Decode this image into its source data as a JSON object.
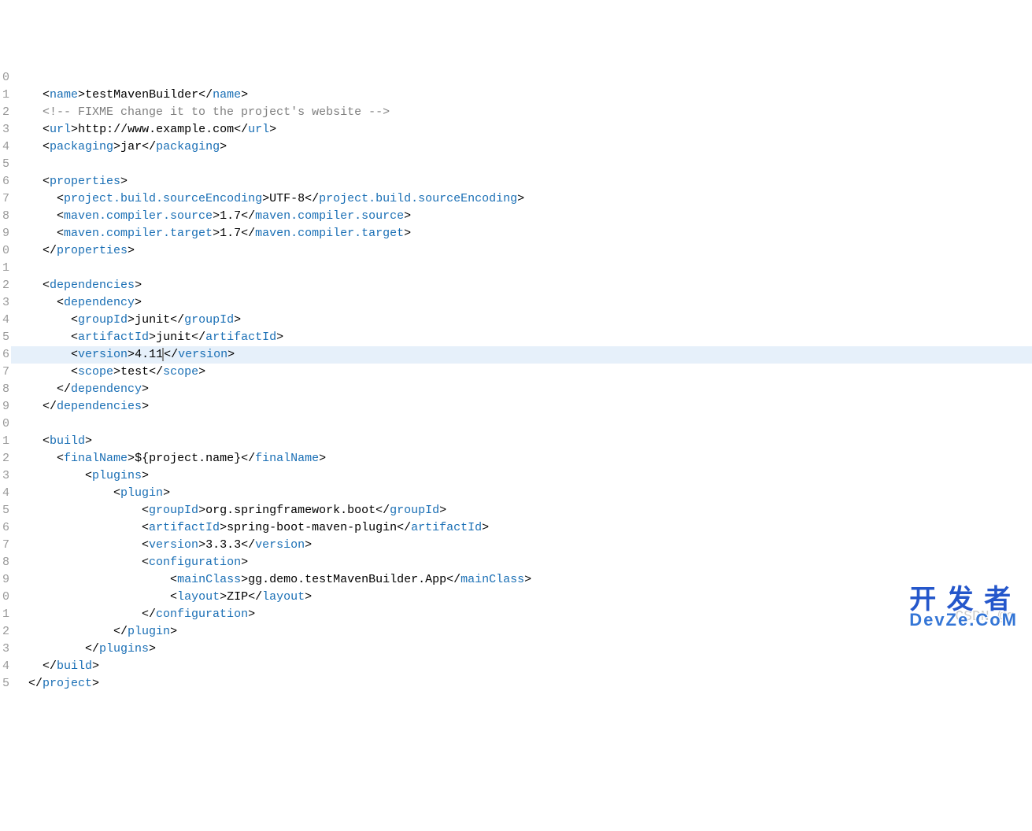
{
  "gutter": [
    "0",
    "1",
    "2",
    "3",
    "4",
    "5",
    "6*",
    "7",
    "8",
    "9",
    "0",
    "1",
    "2",
    "3*",
    "4",
    "5",
    "6",
    "7",
    "8",
    "9",
    "0",
    "1*",
    "2",
    "3*",
    "4*",
    "5",
    "6",
    "7",
    "8*",
    "9",
    "0",
    "1",
    "2",
    "3",
    "4",
    "5"
  ],
  "code": {
    "lines": [
      {
        "indent": 2,
        "open": "name",
        "text": "testMavenBuilder",
        "close": "name"
      },
      {
        "indent": 2,
        "comment": "<!-- FIXME change it to the project's website -->"
      },
      {
        "indent": 2,
        "open": "url",
        "text": "http://www.example.com",
        "close": "url"
      },
      {
        "indent": 2,
        "open": "packaging",
        "text": "jar",
        "close": "packaging"
      },
      {
        "blank": true
      },
      {
        "indent": 2,
        "open": "properties"
      },
      {
        "indent": 4,
        "open": "project.build.sourceEncoding",
        "text": "UTF-8",
        "close": "project.build.sourceEncoding"
      },
      {
        "indent": 4,
        "open": "maven.compiler.source",
        "text": "1.7",
        "close": "maven.compiler.source"
      },
      {
        "indent": 4,
        "open": "maven.compiler.target",
        "text": "1.7",
        "close": "maven.compiler.target"
      },
      {
        "indent": 2,
        "closetag": "properties"
      },
      {
        "blank": true
      },
      {
        "indent": 2,
        "open": "dependencies"
      },
      {
        "indent": 4,
        "open": "dependency"
      },
      {
        "indent": 6,
        "open": "groupId",
        "text": "junit",
        "close": "groupId"
      },
      {
        "indent": 6,
        "open": "artifactId",
        "text": "junit",
        "close": "artifactId"
      },
      {
        "indent": 6,
        "open": "version",
        "text": "4.11",
        "close": "version",
        "hl": true,
        "cursor": true
      },
      {
        "indent": 6,
        "open": "scope",
        "text": "test",
        "close": "scope"
      },
      {
        "indent": 4,
        "closetag": "dependency"
      },
      {
        "indent": 2,
        "closetag": "dependencies"
      },
      {
        "blank": true
      },
      {
        "indent": 2,
        "open": "build"
      },
      {
        "indent": 4,
        "open": "finalName",
        "text": "${project.name}",
        "close": "finalName"
      },
      {
        "indent": 8,
        "open": "plugins"
      },
      {
        "indent": 12,
        "open": "plugin"
      },
      {
        "indent": 16,
        "open": "groupId",
        "text": "org.springframework.boot",
        "close": "groupId"
      },
      {
        "indent": 16,
        "open": "artifactId",
        "text": "spring-boot-maven-plugin",
        "close": "artifactId"
      },
      {
        "indent": 16,
        "open": "version",
        "text": "3.3.3",
        "close": "version"
      },
      {
        "indent": 16,
        "open": "configuration"
      },
      {
        "indent": 20,
        "open": "mainClass",
        "text": "gg.demo.testMavenBuilder.App",
        "close": "mainClass"
      },
      {
        "indent": 20,
        "open": "layout",
        "text": "ZIP",
        "close": "layout"
      },
      {
        "indent": 16,
        "closetag": "configuration"
      },
      {
        "indent": 12,
        "closetag": "plugin"
      },
      {
        "indent": 8,
        "closetag": "plugins"
      },
      {
        "indent": 2,
        "closetag": "build"
      },
      {
        "indent": 0,
        "closetag": "project"
      }
    ]
  },
  "watermark": {
    "csdn": "CSDN @q",
    "cn": "开 发 者",
    "cn2": "DevZe.CoM"
  }
}
